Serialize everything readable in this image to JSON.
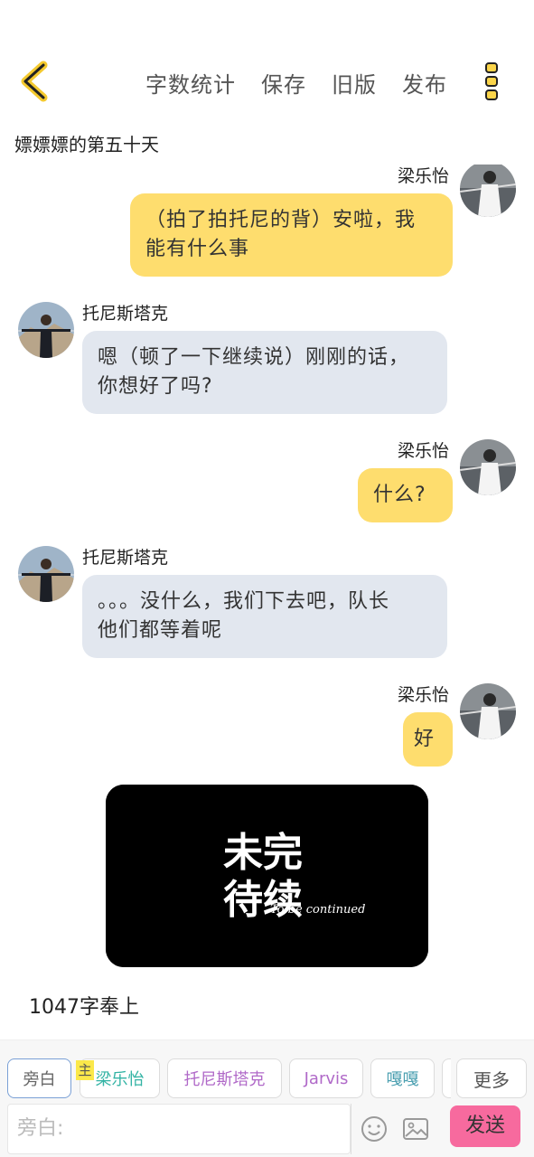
{
  "header": {
    "actions": [
      "字数统计",
      "保存",
      "旧版",
      "发布"
    ]
  },
  "doc_title": "嫖嫖嫖的第五十天",
  "messages": [
    {
      "sender": "梁乐怡",
      "side": "right",
      "text_lines": [
        "（拍了拍托尼的背）安啦，我",
        "能有什么事"
      ]
    },
    {
      "sender": "托尼斯塔克",
      "side": "left",
      "text_lines": [
        "嗯（顿了一下继续说）刚刚的话，",
        "你想好了吗?"
      ]
    },
    {
      "sender": "梁乐怡",
      "side": "right",
      "text_lines": [
        "什么?"
      ]
    },
    {
      "sender": "托尼斯塔克",
      "side": "left",
      "text_lines": [
        "。。。没什么，我们下去吧，队长",
        "他们都等着呢"
      ]
    },
    {
      "sender": "梁乐怡",
      "side": "right",
      "text_lines": [
        "好"
      ]
    }
  ],
  "image_card": {
    "title_lines": [
      "未完",
      "待续"
    ],
    "subtitle": "To be continued"
  },
  "word_count": "1047字奉上",
  "roles": {
    "badge": "主",
    "chips": [
      "旁白",
      "梁乐怡",
      "托尼斯塔克",
      "Jarvis",
      "嘎嘎",
      "",
      "更多"
    ]
  },
  "input": {
    "placeholder": "旁白:"
  },
  "send_label": "发送",
  "colors": {
    "accent": "#fedd6e",
    "send": "#f76a9e",
    "chip_teal": "#32b3a4",
    "chip_purple": "#b069c8",
    "chip_teal2": "#4a9fb0"
  }
}
